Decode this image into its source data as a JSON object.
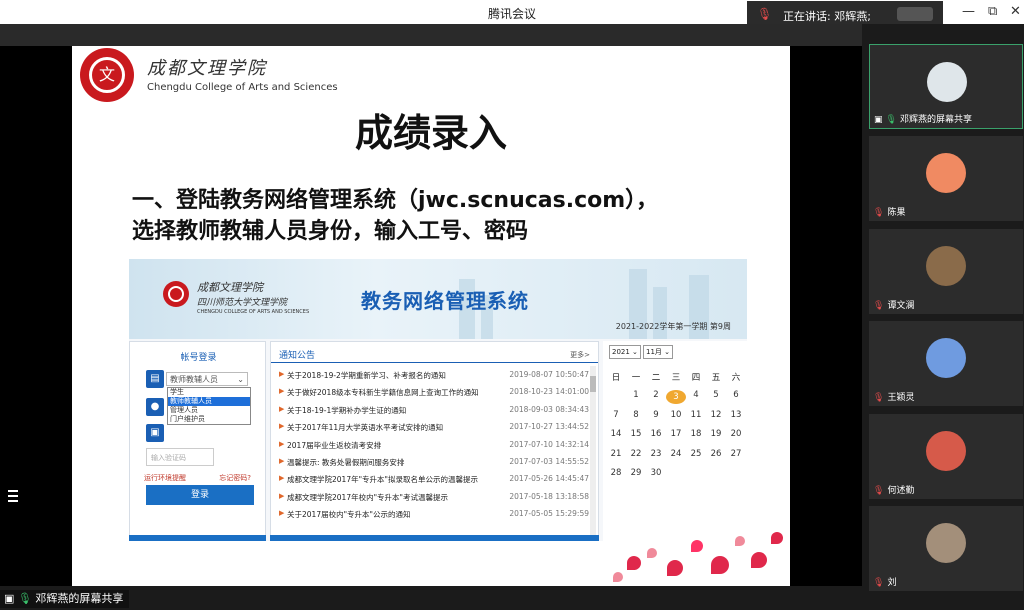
{
  "window": {
    "title": "腾讯会议",
    "speaking_label": "正在讲话: 邓辉燕;",
    "minimize": "—",
    "restore": "⧉",
    "close": "✕"
  },
  "slide": {
    "college_cn": "成都文理学院",
    "college_en": "Chengdu College of Arts and Sciences",
    "title": "成绩录入",
    "line1": "一、登陆教务网络管理系统（jwc.scnucas.com），",
    "line2": "选择教师教辅人员身份，输入工号、密码"
  },
  "portal": {
    "logo_cn1": "成都文理学院",
    "logo_cn2": "四川师范大学文理学院",
    "logo_en": "CHENGDU COLLEGE OF ARTS AND SCIENCES",
    "title": "教务网络管理系统",
    "term": "2021-2022学年第一学期  第9周",
    "login": {
      "title": "帐号登录",
      "selected": "教师教辅人员",
      "options": [
        "学生",
        "教师教辅人员",
        "管理人员",
        "门户维护员"
      ],
      "highlighted_option_index": 1,
      "captcha_placeholder": "输入验证码",
      "env_link": "运行环境提醒",
      "forgot_link": "忘记密码?",
      "login_button": "登录"
    },
    "news": {
      "title": "通知公告",
      "more": "更多>",
      "items": [
        {
          "title": "关于2018-19-2学期重新学习、补考报名的通知",
          "date": "2019-08-07 10:50:47"
        },
        {
          "title": "关于做好2018级本专科新生学籍信息网上查询工作的通知",
          "date": "2018-10-23 14:01:00"
        },
        {
          "title": "关于18-19-1学期补办学生证的通知",
          "date": "2018-09-03 08:34:43"
        },
        {
          "title": "关于2017年11月大学英语水平考试安排的通知",
          "date": "2017-10-27 13:44:52"
        },
        {
          "title": "2017届毕业生返校清考安排",
          "date": "2017-07-10 14:32:14"
        },
        {
          "title": "温馨提示: 教务处暑假期间服务安排",
          "date": "2017-07-03 14:55:52"
        },
        {
          "title": "成都文理学院2017年\"专升本\"拟录取名单公示的温馨提示",
          "date": "2017-05-26 14:45:47"
        },
        {
          "title": "成都文理学院2017年校内\"专升本\"考试温馨提示",
          "date": "2017-05-18 13:18:58"
        },
        {
          "title": "关于2017届校内\"专升本\"公示的通知",
          "date": "2017-05-05 15:29:59"
        }
      ]
    },
    "calendar": {
      "year": "2021",
      "month": "11月",
      "weekdays": [
        "日",
        "一",
        "二",
        "三",
        "四",
        "五",
        "六"
      ],
      "weeks": [
        [
          "",
          "1",
          "2",
          "3",
          "4",
          "5",
          "6"
        ],
        [
          "7",
          "8",
          "9",
          "10",
          "11",
          "12",
          "13"
        ],
        [
          "14",
          "15",
          "16",
          "17",
          "18",
          "19",
          "20"
        ],
        [
          "21",
          "22",
          "23",
          "24",
          "25",
          "26",
          "27"
        ],
        [
          "28",
          "29",
          "30",
          "",
          "",
          "",
          ""
        ]
      ],
      "today": "3"
    }
  },
  "participants": [
    {
      "name": "邓辉燕的屏幕共享",
      "sharing": true,
      "avatar_color": "#dfe6ea"
    },
    {
      "name": "陈果",
      "sharing": false,
      "avatar_color": "#f08a62"
    },
    {
      "name": "谭文澜",
      "sharing": false,
      "avatar_color": "#8a6b4a"
    },
    {
      "name": "王颖灵",
      "sharing": false,
      "avatar_color": "#6f9be0"
    },
    {
      "name": "何述勤",
      "sharing": false,
      "avatar_color": "#d65a4a"
    },
    {
      "name": "刘",
      "sharing": false,
      "avatar_color": "#a38f7a"
    }
  ],
  "bottom": {
    "share_label": "邓辉燕的屏幕共享"
  },
  "colors": {
    "brand_red": "#c9191e",
    "portal_blue": "#1a5fb4",
    "active_border": "#3aa16b",
    "muted_mic": "#e34b4b"
  }
}
